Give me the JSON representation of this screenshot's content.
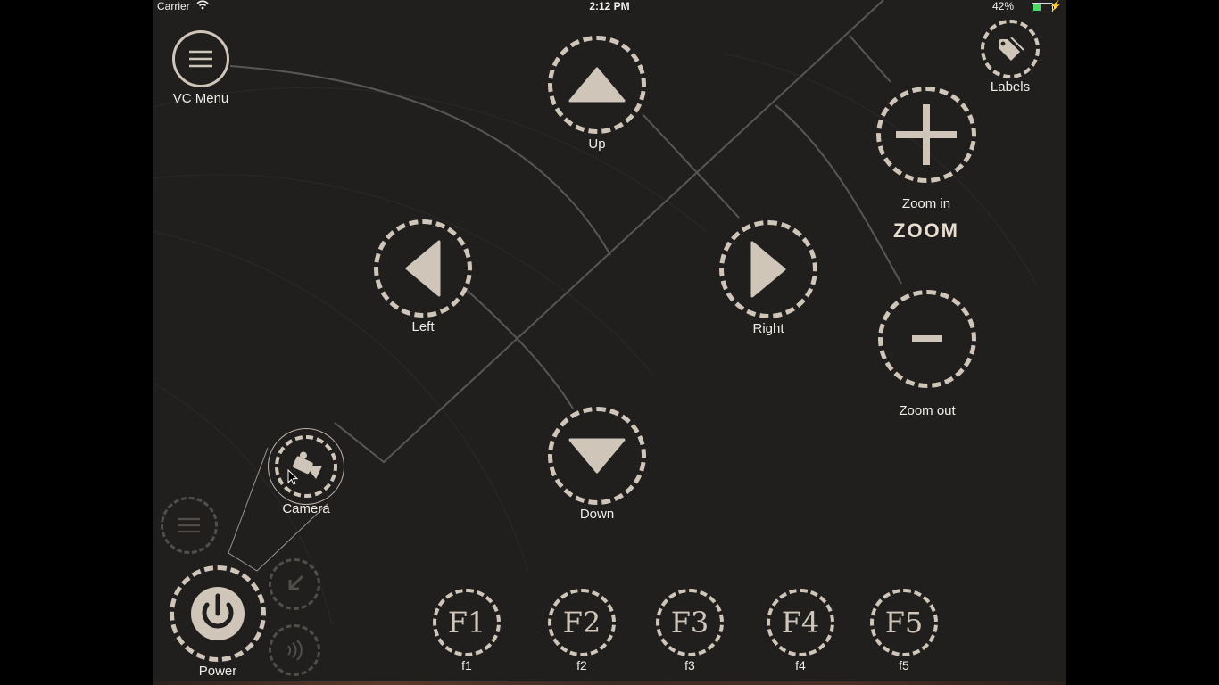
{
  "status_bar": {
    "carrier": "Carrier",
    "time": "2:12 PM",
    "battery": "42%",
    "battery_level": 0.42
  },
  "menu": {
    "label": "VC Menu",
    "icon": "hamburger-icon"
  },
  "labels_button": {
    "label": "Labels",
    "icon": "tag-icon"
  },
  "directions": {
    "up": "Up",
    "down": "Down",
    "left": "Left",
    "right": "Right"
  },
  "zoom": {
    "title": "ZOOM",
    "in_label": "Zoom in",
    "out_label": "Zoom out"
  },
  "camera": {
    "label": "Camera",
    "icon": "video-camera-icon"
  },
  "power": {
    "label": "Power",
    "icon": "power-icon"
  },
  "function_keys": [
    {
      "glyph": "F1",
      "label": "f1"
    },
    {
      "glyph": "F2",
      "label": "f2"
    },
    {
      "glyph": "F3",
      "label": "f3"
    },
    {
      "glyph": "F4",
      "label": "f4"
    },
    {
      "glyph": "F5",
      "label": "f5"
    }
  ],
  "colors": {
    "background": "#211f1e",
    "ring": "#cfc5b9",
    "text": "#f0ece7"
  }
}
